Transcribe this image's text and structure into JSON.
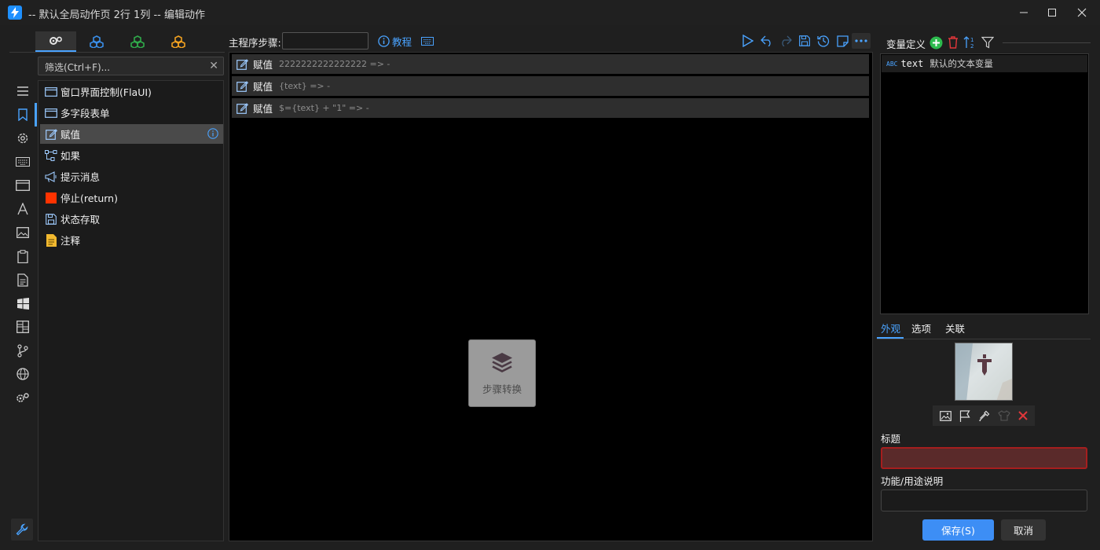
{
  "window": {
    "title": "-- 默认全局动作页 2行 1列 -- 编辑动作"
  },
  "colors": {
    "accent": "#4aa3ff",
    "play": "#4aa3ff",
    "add": "#2dbb4e",
    "delete": "#e0373a",
    "stop": "#ff3300",
    "note": "#f2b92f",
    "save": "#3d8ef5",
    "title_error_border": "#a61e1e"
  },
  "left": {
    "category_tabs": [
      {
        "icon": "gears-icon",
        "color": "#e6e6e6"
      },
      {
        "icon": "cubes-blue-icon",
        "color": "#3a8ee8"
      },
      {
        "icon": "cubes-green-icon",
        "color": "#2faa4a"
      },
      {
        "icon": "cubes-orange-icon",
        "color": "#f0a020"
      }
    ],
    "filter": {
      "placeholder": "筛选(Ctrl+F)..."
    },
    "actions": [
      {
        "label": "窗口界面控制(FlaUI)",
        "icon": "window-icon"
      },
      {
        "label": "多字段表单",
        "icon": "form-icon"
      },
      {
        "label": "赋值",
        "icon": "edit-icon",
        "selected": true
      },
      {
        "label": "如果",
        "icon": "branch-icon"
      },
      {
        "label": "提示消息",
        "icon": "megaphone-icon"
      },
      {
        "label": "停止(return)",
        "icon": "stop-icon"
      },
      {
        "label": "状态存取",
        "icon": "save-icon"
      },
      {
        "label": "注释",
        "icon": "note-icon"
      }
    ]
  },
  "rail": {
    "icons": [
      "menu-icon",
      "bookmark-icon",
      "settings-icon",
      "keyboard-icon",
      "window-icon",
      "font-icon",
      "image-icon",
      "clipboard-icon",
      "document-icon",
      "windows-icon",
      "grid-icon",
      "git-icon",
      "globe-icon",
      "gears-icon"
    ]
  },
  "center": {
    "main_label": "主程序步骤:",
    "tutorial_label": "教程",
    "steps": [
      {
        "name": "赋值",
        "detail": "2222222222222222 => -"
      },
      {
        "name": "赋值",
        "detail": "{text} => -"
      },
      {
        "name": "赋值",
        "detail": "$={text} + \"1\" => -"
      }
    ],
    "convert_label": "步骤转换"
  },
  "right": {
    "var_title": "变量定义",
    "variables": [
      {
        "type": "ABC",
        "name": "text",
        "desc": "默认的文本变量"
      }
    ],
    "tabs": [
      "外观",
      "选项",
      "关联"
    ],
    "title_label": "标题",
    "title_value": "",
    "desc_label": "功能/用途说明",
    "desc_value": "",
    "save_label": "保存(S)",
    "cancel_label": "取消"
  }
}
